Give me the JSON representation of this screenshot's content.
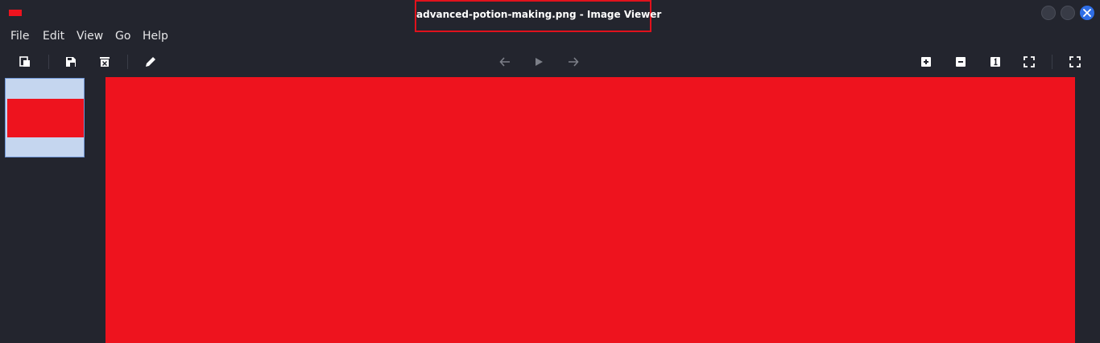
{
  "window": {
    "title": "advanced-potion-making.png - Image Viewer",
    "controls": [
      "minimize-button",
      "maximize-button",
      "close-button"
    ]
  },
  "menu": [
    {
      "label": "File"
    },
    {
      "label": "Edit"
    },
    {
      "label": "View"
    },
    {
      "label": "Go"
    },
    {
      "label": "Help"
    }
  ],
  "toolbar": {
    "left": [
      "open-icon",
      "save-icon",
      "delete-icon",
      "edit-icon"
    ],
    "center": [
      "back-arrow-icon",
      "play-icon",
      "forward-arrow-icon"
    ],
    "right": [
      "zoom-in-icon",
      "zoom-out-icon",
      "actual-size-icon",
      "fit-icon",
      "fullscreen-icon"
    ]
  },
  "thumbnail": {
    "selected": true
  },
  "colors": {
    "background": "#23252e",
    "image_fill": "#ee131e",
    "thumb_bg": "#c5d6ef",
    "highlight_border": "#e0121c",
    "close_button": "#2f6ee6"
  }
}
